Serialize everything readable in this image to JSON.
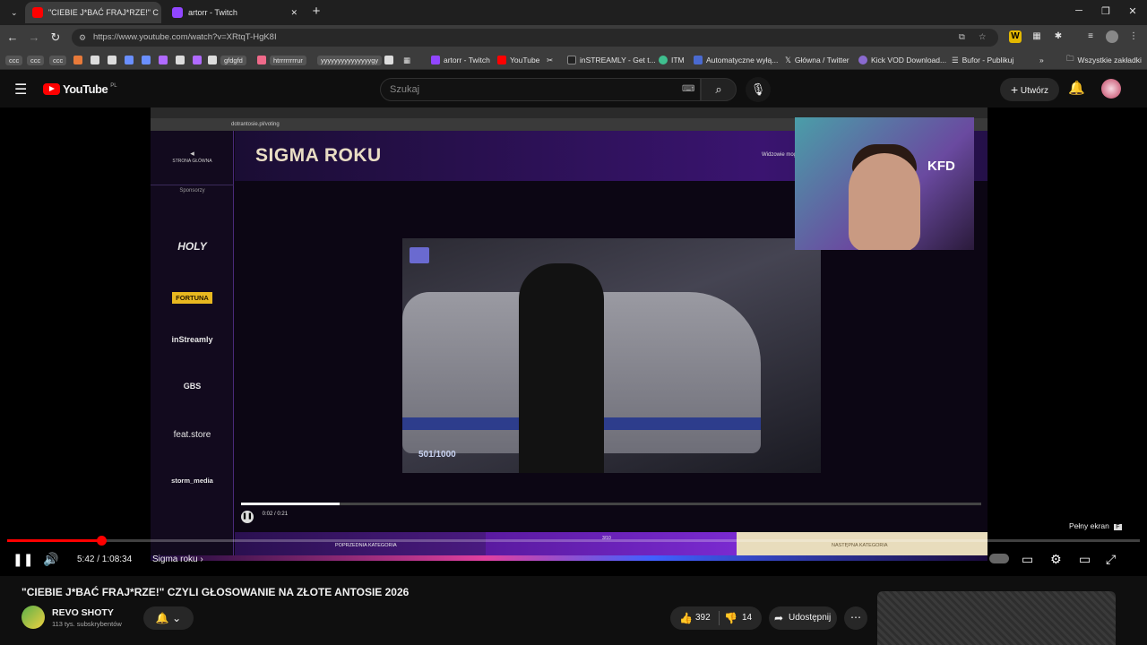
{
  "browser": {
    "tabs": [
      {
        "label": "\"CIEBIE J*BAĆ FRAJ*RZE!\" C",
        "color": "#ff0000"
      },
      {
        "label": "artorr - Twitch",
        "color": "#9146ff"
      }
    ],
    "url": "https://www.youtube.com/watch?v=XRtqT-HgK8I",
    "bookmarks": [
      {
        "label": "ccc"
      },
      {
        "label": "ccc"
      },
      {
        "label": "ccc"
      },
      {
        "label": "gfdgfd"
      },
      {
        "label": "htrrrrrrrrur"
      },
      {
        "label": "yyyyyyyyyyyyyyygy"
      },
      {
        "label": "artorr - Twitch"
      },
      {
        "label": "YouTube"
      },
      {
        "label": "inSTREAMLY - Get t..."
      },
      {
        "label": "ITM"
      },
      {
        "label": "Automatyczne wyłą..."
      },
      {
        "label": "Główna / Twitter"
      },
      {
        "label": "Kick VOD Download..."
      },
      {
        "label": "Bufor - Publikuj"
      }
    ],
    "all_bookmarks": "Wszystkie zakładki"
  },
  "youtube": {
    "logo": "YouTube",
    "logo_region": "PL",
    "search_placeholder": "Szukaj",
    "create_label": "Utwórz"
  },
  "stream": {
    "site_url": "dotrantosie.pl/voting",
    "sidebar_home": "STRONA GŁÓWNA",
    "sponsors_label": "Sponsorzy",
    "sponsors": [
      "HOLY",
      "FORTUNA",
      "inStreamly",
      "GBS",
      "feat.store",
      "storm_media"
    ],
    "page_title": "SIGMA ROKU",
    "header_note": "Widzowie mog",
    "video_counter": "501/1000",
    "inner_time": "0:02 / 0:21",
    "webcam_logo": "KFD",
    "prev_category": "POPRZEDNIA KATEGORIA",
    "next_category": "NASTĘPNA KATEGORIA",
    "category_counter": "3/10"
  },
  "player": {
    "time": "5:42 / 1:08:34",
    "chapter": "Sigma roku",
    "fullscreen_tip": "Pełny ekran",
    "fullscreen_key": "F",
    "progress_fraction": 0.083
  },
  "video": {
    "title": "\"CIEBIE J*BAĆ FRAJ*RZE!\" CZYLI GŁOSOWANIE NA ZŁOTE ANTOSIE 2026",
    "channel": "REVO SHOTY",
    "subscribers": "113 tys. subskrybentów",
    "likes": "392",
    "dislikes": "14",
    "share_label": "Udostępnij"
  }
}
